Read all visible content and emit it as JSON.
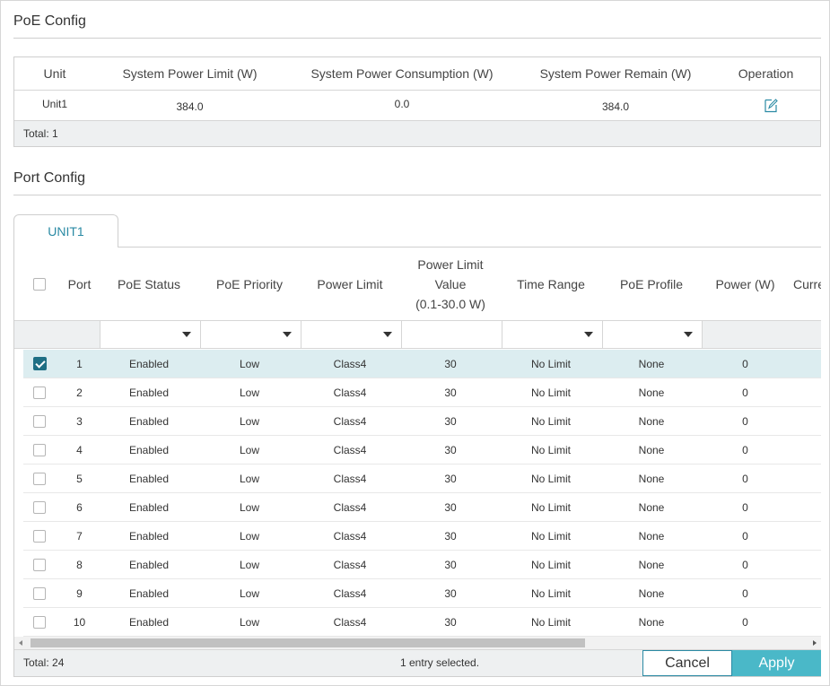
{
  "poe_config": {
    "title": "PoE Config",
    "columns": [
      "Unit",
      "System Power Limit (W)",
      "System Power Consumption (W)",
      "System Power Remain (W)",
      "Operation"
    ],
    "rows": [
      {
        "unit": "Unit1",
        "limit": "384.0",
        "consumption": "0.0",
        "remain": "384.0",
        "operation_icon": "edit-icon"
      }
    ],
    "total": "Total: 1"
  },
  "port_config": {
    "title": "Port Config",
    "tab": "UNIT1",
    "columns": {
      "port": "Port",
      "status": "PoE Status",
      "priority": "PoE Priority",
      "limit": "Power Limit",
      "limit_value_1": "Power Limit",
      "limit_value_2": "Value",
      "limit_value_3": "(0.1-30.0 W)",
      "time_range": "Time Range",
      "profile": "PoE Profile",
      "power": "Power (W)",
      "current": "Current"
    },
    "rows": [
      {
        "port": "1",
        "status": "Enabled",
        "priority": "Low",
        "limit": "Class4",
        "value": "30",
        "time_range": "No Limit",
        "profile": "None",
        "power": "0",
        "checked": true
      },
      {
        "port": "2",
        "status": "Enabled",
        "priority": "Low",
        "limit": "Class4",
        "value": "30",
        "time_range": "No Limit",
        "profile": "None",
        "power": "0",
        "checked": false
      },
      {
        "port": "3",
        "status": "Enabled",
        "priority": "Low",
        "limit": "Class4",
        "value": "30",
        "time_range": "No Limit",
        "profile": "None",
        "power": "0",
        "checked": false
      },
      {
        "port": "4",
        "status": "Enabled",
        "priority": "Low",
        "limit": "Class4",
        "value": "30",
        "time_range": "No Limit",
        "profile": "None",
        "power": "0",
        "checked": false
      },
      {
        "port": "5",
        "status": "Enabled",
        "priority": "Low",
        "limit": "Class4",
        "value": "30",
        "time_range": "No Limit",
        "profile": "None",
        "power": "0",
        "checked": false
      },
      {
        "port": "6",
        "status": "Enabled",
        "priority": "Low",
        "limit": "Class4",
        "value": "30",
        "time_range": "No Limit",
        "profile": "None",
        "power": "0",
        "checked": false
      },
      {
        "port": "7",
        "status": "Enabled",
        "priority": "Low",
        "limit": "Class4",
        "value": "30",
        "time_range": "No Limit",
        "profile": "None",
        "power": "0",
        "checked": false
      },
      {
        "port": "8",
        "status": "Enabled",
        "priority": "Low",
        "limit": "Class4",
        "value": "30",
        "time_range": "No Limit",
        "profile": "None",
        "power": "0",
        "checked": false
      },
      {
        "port": "9",
        "status": "Enabled",
        "priority": "Low",
        "limit": "Class4",
        "value": "30",
        "time_range": "No Limit",
        "profile": "None",
        "power": "0",
        "checked": false
      },
      {
        "port": "10",
        "status": "Enabled",
        "priority": "Low",
        "limit": "Class4",
        "value": "30",
        "time_range": "No Limit",
        "profile": "None",
        "power": "0",
        "checked": false
      }
    ],
    "total": "Total: 24",
    "selection": "1 entry selected.",
    "cancel_label": "Cancel",
    "apply_label": "Apply"
  },
  "colors": {
    "accent": "#2a8aa4",
    "apply": "#4ab8c8",
    "selected_row": "#dcedf0",
    "checkbox_on": "#1f6f84"
  }
}
